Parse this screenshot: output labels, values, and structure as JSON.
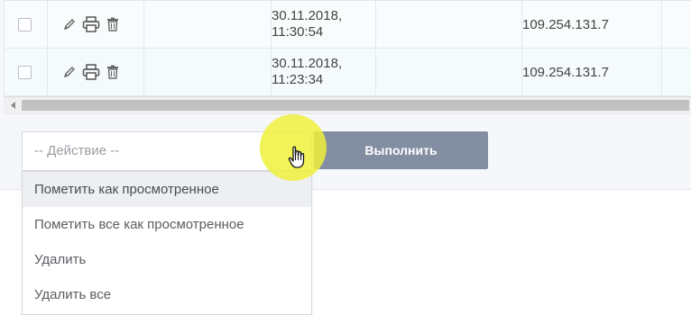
{
  "table": {
    "rows": [
      {
        "datetime_line1": "30.11.2018,",
        "datetime_line2": "11:30:54",
        "ip": "109.254.131.7"
      },
      {
        "datetime_line1": "30.11.2018,",
        "datetime_line2": "11:23:34",
        "ip": "109.254.131.7"
      }
    ]
  },
  "action_select": {
    "placeholder": "-- Действие --",
    "options": [
      "Пометить как просмотренное",
      "Пометить все как просмотренное",
      "Удалить",
      "Удалить все"
    ],
    "highlighted_index": 0
  },
  "run_button": {
    "label": "Выполнить"
  },
  "icons": [
    "edit-icon",
    "print-icon",
    "trash-icon",
    "scroll-left-icon",
    "hand-cursor-icon"
  ],
  "colors": {
    "button_bg": "#838ea3",
    "cursor_highlight": "#f0f03c"
  }
}
